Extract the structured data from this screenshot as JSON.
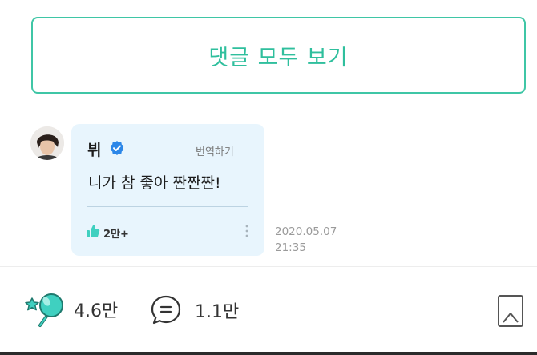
{
  "view_all": {
    "label": "댓글 모두 보기"
  },
  "comment": {
    "author": "뷔",
    "translate_label": "번역하기",
    "text": "니가 참 좋아 짠짠짠!",
    "likes": "2만+",
    "date": "2020.05.07",
    "time": "21:35",
    "icons": [
      "avatar",
      "verified-badge-icon",
      "thumbs-up-icon",
      "more-vertical-icon"
    ]
  },
  "footer": {
    "likes": "4.6만",
    "comments": "1.1만",
    "icons": [
      "star-wand-icon",
      "comment-bubble-icon",
      "bookmark-icon"
    ]
  },
  "colors": {
    "accent": "#2fbf9d",
    "bubble_bg": "#e8f5fd",
    "verified": "#2c87e8",
    "icon_teal": "#3fd0c0"
  }
}
